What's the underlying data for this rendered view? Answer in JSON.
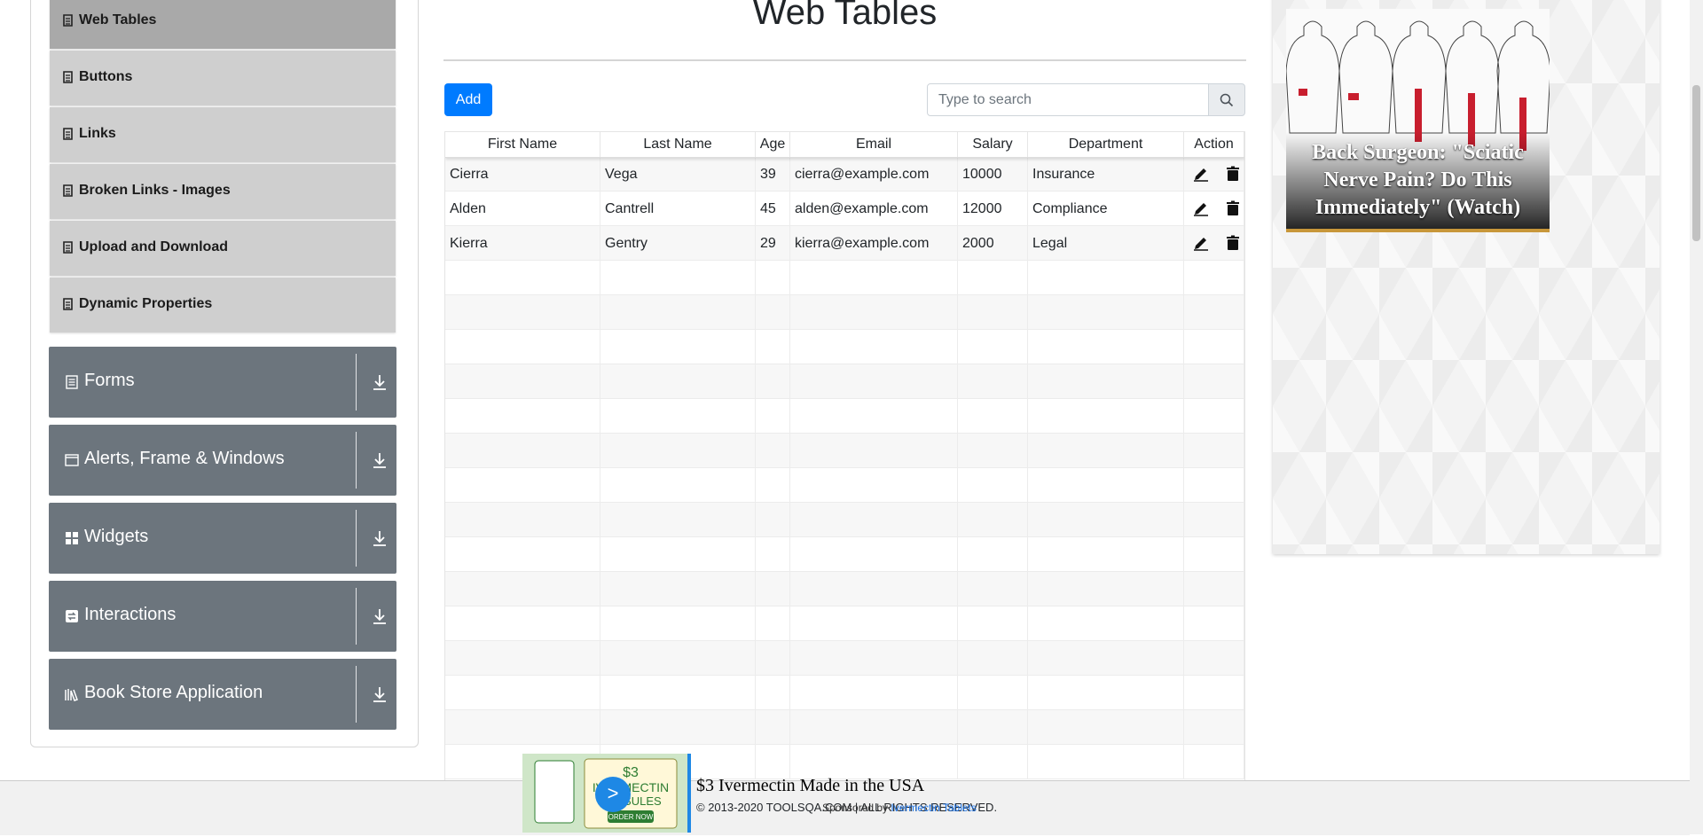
{
  "sidebar": {
    "sub_items": [
      {
        "label": "Web Tables",
        "active": true
      },
      {
        "label": "Buttons"
      },
      {
        "label": "Links"
      },
      {
        "label": "Broken Links - Images"
      },
      {
        "label": "Upload and Download"
      },
      {
        "label": "Dynamic Properties"
      }
    ],
    "groups": [
      {
        "label": "Forms",
        "icon": "forms-icon"
      },
      {
        "label": "Alerts, Frame & Windows",
        "icon": "window-icon"
      },
      {
        "label": "Widgets",
        "icon": "widgets-icon"
      },
      {
        "label": "Interactions",
        "icon": "interactions-icon"
      },
      {
        "label": "Book Store Application",
        "icon": "books-icon"
      }
    ]
  },
  "main": {
    "title": "Web Tables",
    "add_label": "Add",
    "search_placeholder": "Type to search"
  },
  "table": {
    "headers": [
      "First Name",
      "Last Name",
      "Age",
      "Email",
      "Salary",
      "Department",
      "Action"
    ],
    "rows": [
      [
        "Cierra",
        "Vega",
        "39",
        "cierra@example.com",
        "10000",
        "Insurance"
      ],
      [
        "Alden",
        "Cantrell",
        "45",
        "alden@example.com",
        "12000",
        "Compliance"
      ],
      [
        "Kierra",
        "Gentry",
        "29",
        "kierra@example.com",
        "2000",
        "Legal"
      ]
    ]
  },
  "ad_right": {
    "headline": "Back Surgeon: \"Sciatic Nerve Pain? Do This Immediately\" (Watch)"
  },
  "ad_bottom": {
    "headline": "$3 Ivermectin Made in the USA",
    "sponsor": "Sponsored by",
    "sponsor_name": "Ivermectin Tablets",
    "image_text_1": "$3",
    "image_text_2": "IVERMECTIN",
    "image_text_3": "CAPSULES",
    "image_text_4": "ORDER NOW",
    "go_label": ">"
  },
  "footer": {
    "copyright": "© 2013-2020 TOOLSQA.COM | ALL RIGHTS RESERVED."
  }
}
